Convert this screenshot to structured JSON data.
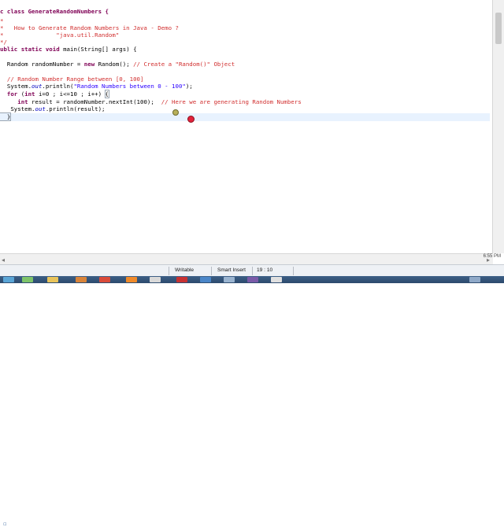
{
  "code": {
    "l1": "c class GenerateRandomNumbers {",
    "l2": "*",
    "l3": "*   How to Generate Random Numbers in Java - Demo ?",
    "l4": "*               \"java.util.Random\"",
    "l5": "*/",
    "l6a": "ublic static void",
    "l6b": " main(String[] args) {",
    "l7a": "  Random randomNumber = ",
    "l7b": "new",
    "l7c": " Random(); ",
    "l7d": "// Create a \"Random()\" Object",
    "l8": "  // Random Number Range between [0, 100]",
    "l9a": "  System.",
    "l9b": "out",
    "l9c": ".println(",
    "l9d": "\"Random Numbers between 0 - 100\"",
    "l9e": ");",
    "l10a": "  for",
    "l10b": " (",
    "l10c": "int",
    "l10d": " i=0 ; i<=10 ; i++) ",
    "l10e": "{",
    "l11a": "     int",
    "l11b": " result = randomNumber.nextInt(100);  ",
    "l11c": "// Here we are generating Random Numbers",
    "l12a": "   System.",
    "l12b": "out",
    "l12c": ".println(result);",
    "l13": "  }"
  },
  "status": {
    "writable": "Writable",
    "insert_mode": "Smart Insert",
    "position": "19 : 10"
  },
  "clock": "6:55 PM",
  "colors": {
    "keyword": "#7f0055",
    "comment": "#d12f2f",
    "string": "#2a00ff",
    "field": "#0000c0",
    "current_line": "#e8f2fe",
    "taskbar": "#2c4a6d"
  },
  "taskbar_icons": [
    "start-icon",
    "explorer-icon",
    "media-icon",
    "browser-icon",
    "chrome-icon",
    "app-icon",
    "app-icon-2",
    "app-icon-3",
    "app-icon-4",
    "app-icon-5",
    "app-icon-6",
    "app-icon-7",
    "app-icon-8"
  ]
}
